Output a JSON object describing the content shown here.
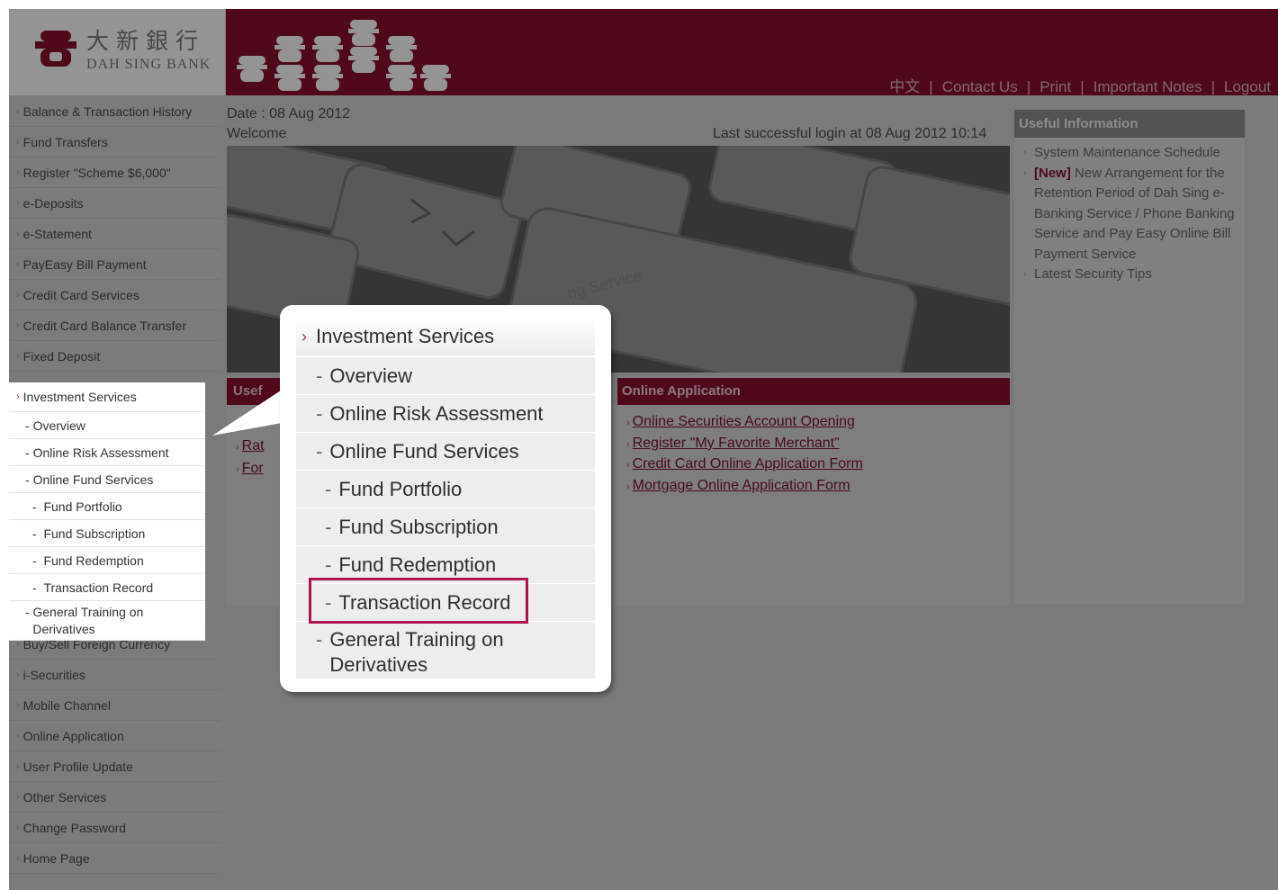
{
  "brand": {
    "name_cn": "大新銀行",
    "name_en": "DAH SING BANK"
  },
  "top_nav": {
    "chinese": "中文",
    "contact": "Contact Us",
    "print": "Print",
    "notes": "Important Notes",
    "logout": "Logout"
  },
  "left_menu": {
    "top_items": [
      "Balance & Transaction History",
      "Fund Transfers",
      "Register \"Scheme $6,000\"",
      "e-Deposits",
      "e-Statement",
      "PayEasy Bill Payment",
      "Credit Card Services",
      "Credit Card Balance Transfer",
      "Fixed Deposit"
    ],
    "expanded": {
      "head": "Investment Services",
      "overview": "Overview",
      "risk": "Online Risk Assessment",
      "fund_services": "Online Fund Services",
      "portfolio": "Fund Portfolio",
      "subscription": "Fund Subscription",
      "redemption": "Fund Redemption",
      "transaction": "Transaction Record",
      "training": "General Training on Derivatives"
    },
    "bottom_items": [
      "Buy/Sell Foreign Currency",
      "i-Securities",
      "Mobile Channel",
      "Online Application",
      "User Profile Update",
      "Other Services",
      "Change Password",
      "Home Page"
    ]
  },
  "main": {
    "date": "Date : 08 Aug 2012",
    "welcome": "Welcome",
    "last_login": "Last successful login at 08 Aug 2012 10:14",
    "hero_watermark": "ng Service",
    "useful_bar": "Usef",
    "useful_links": [
      "Rat",
      "For"
    ],
    "online_bar": "Online Application",
    "online_links": [
      "Online Securities Account Opening",
      "Register \"My Favorite Merchant\"",
      "Credit Card Online Application Form",
      "Mortgage Online Application Form"
    ]
  },
  "right_panel": {
    "title": "Useful Information",
    "item1": "System Maintenance Schedule",
    "new_tag": "[New]",
    "item2": "New Arrangement for the Retention Period of Dah Sing e-Banking Service / Phone Banking Service and Pay Easy Online Bill Payment Service",
    "item3": "Latest Security Tips"
  },
  "callout": {
    "head": "Investment Services",
    "overview": "Overview",
    "risk": "Online Risk Assessment",
    "fund_services": "Online Fund Services",
    "portfolio": "Fund Portfolio",
    "subscription": "Fund Subscription",
    "redemption": "Fund Redemption",
    "transaction": "Transaction Record",
    "training": "General Training on Derivatives"
  },
  "colors": {
    "brand": "#8a1030",
    "highlight": "#b0124e"
  }
}
